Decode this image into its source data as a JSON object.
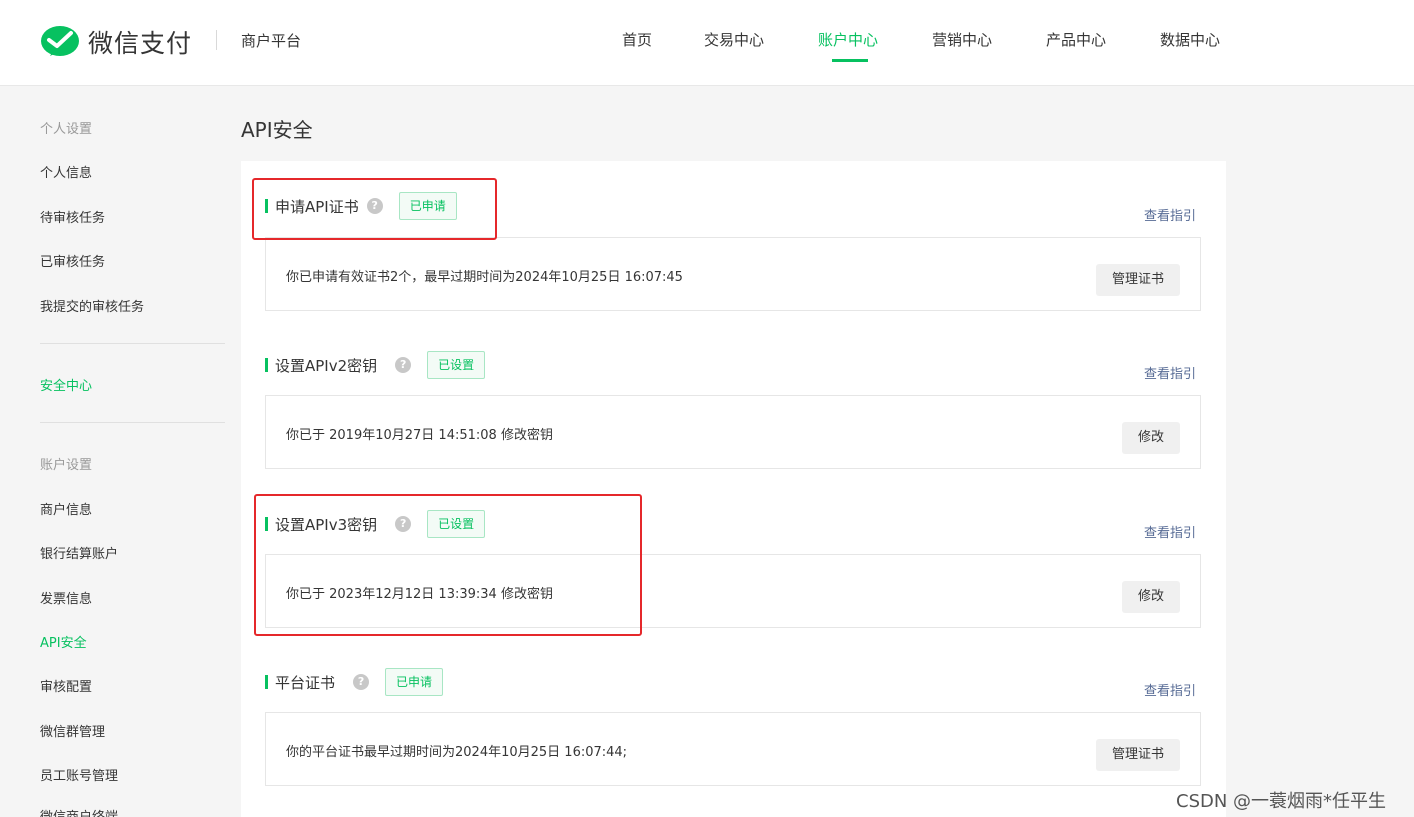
{
  "header": {
    "logo_text": "微信支付",
    "platform": "商户平台",
    "nav": [
      {
        "label": "首页",
        "active": false
      },
      {
        "label": "交易中心",
        "active": false
      },
      {
        "label": "账户中心",
        "active": true
      },
      {
        "label": "营销中心",
        "active": false
      },
      {
        "label": "产品中心",
        "active": false
      },
      {
        "label": "数据中心",
        "active": false
      }
    ]
  },
  "sidebar": {
    "group1": "个人设置",
    "group1_items": [
      "个人信息",
      "待审核任务",
      "已审核任务",
      "我提交的审核任务"
    ],
    "security": "安全中心",
    "group2": "账户设置",
    "group2_items": [
      "商户信息",
      "银行结算账户",
      "发票信息",
      "API安全",
      "审核配置",
      "微信群管理",
      "员工账号管理",
      "微信商户终端"
    ],
    "active_item": "API安全"
  },
  "main": {
    "page_title": "API安全",
    "sections": [
      {
        "title": "申请API证书",
        "badge": "已申请",
        "guide": "查看指引",
        "text": "你已申请有效证书2个，最早过期时间为2024年10月25日 16:07:45",
        "button": "管理证书"
      },
      {
        "title": "设置APIv2密钥",
        "badge": "已设置",
        "guide": "查看指引",
        "text": "你已于 2019年10月27日 14:51:08 修改密钥",
        "button": "修改"
      },
      {
        "title": "设置APIv3密钥",
        "badge": "已设置",
        "guide": "查看指引",
        "text": "你已于 2023年12月12日 13:39:34 修改密钥",
        "button": "修改"
      },
      {
        "title": "平台证书",
        "badge": "已申请",
        "guide": "查看指引",
        "text": "你的平台证书最早过期时间为2024年10月25日 16:07:44;",
        "button": "管理证书"
      }
    ]
  },
  "watermark": "CSDN @一蓑烟雨*任平生",
  "colors": {
    "accent": "#07c160",
    "link": "#576b95",
    "highlight": "#e5282b"
  }
}
